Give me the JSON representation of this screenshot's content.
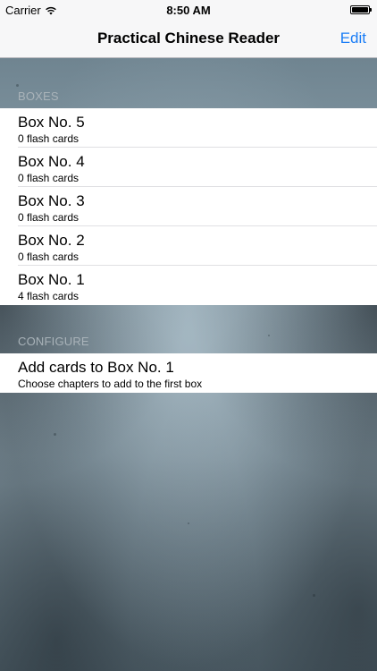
{
  "status_bar": {
    "carrier": "Carrier",
    "time": "8:50 AM"
  },
  "nav": {
    "title": "Practical Chinese Reader",
    "edit_label": "Edit"
  },
  "sections": {
    "boxes": {
      "header": "BOXES",
      "items": [
        {
          "title": "Box No. 5",
          "subtitle": "0 flash cards"
        },
        {
          "title": "Box No. 4",
          "subtitle": "0 flash cards"
        },
        {
          "title": "Box No. 3",
          "subtitle": "0 flash cards"
        },
        {
          "title": "Box No. 2",
          "subtitle": "0 flash cards"
        },
        {
          "title": "Box No. 1",
          "subtitle": "4 flash cards"
        }
      ]
    },
    "configure": {
      "header": "CONFIGURE",
      "items": [
        {
          "title": "Add cards to Box No. 1",
          "subtitle": "Choose chapters to add to the first box"
        }
      ]
    }
  },
  "colors": {
    "accent": "#1a7df6",
    "section_header": "#a9b3b9",
    "background_texture": "#7f929c"
  },
  "icons": [
    "wifi-icon",
    "battery-icon"
  ]
}
